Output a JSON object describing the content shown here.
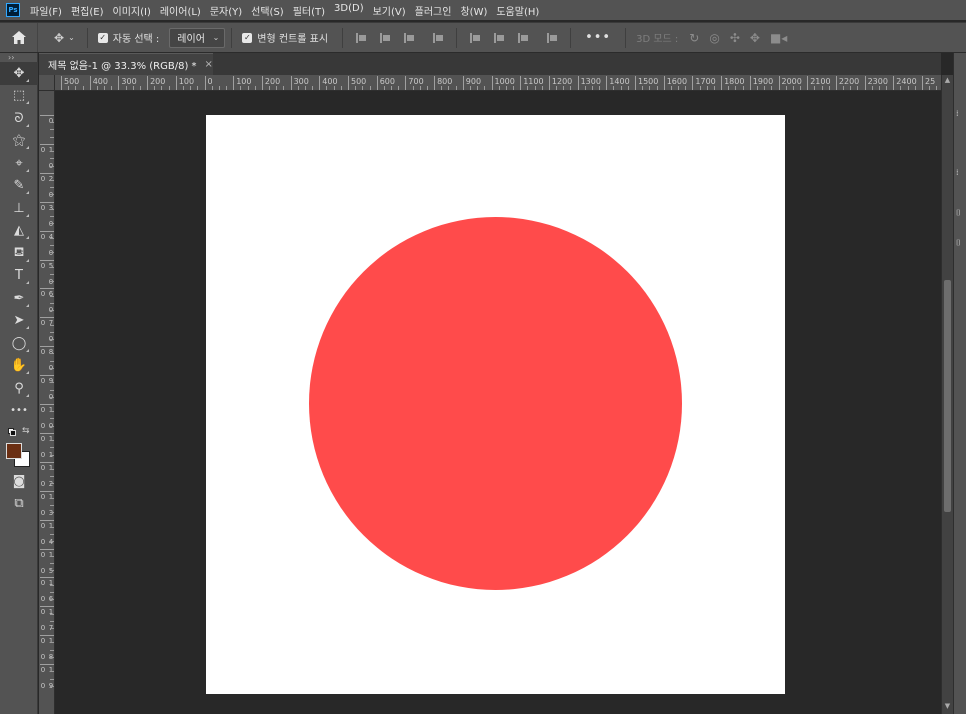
{
  "app": {
    "logo_text": "Ps"
  },
  "menu": [
    {
      "label": "파일(F)"
    },
    {
      "label": "편집(E)"
    },
    {
      "label": "이미지(I)"
    },
    {
      "label": "레이어(L)"
    },
    {
      "label": "문자(Y)"
    },
    {
      "label": "선택(S)"
    },
    {
      "label": "필터(T)"
    },
    {
      "label": "3D(D)"
    },
    {
      "label": "보기(V)"
    },
    {
      "label": "플러그인"
    },
    {
      "label": "창(W)"
    },
    {
      "label": "도움말(H)"
    }
  ],
  "options": {
    "home_icon": "home-icon",
    "move_icon": "move-tool-icon",
    "auto_select_checked": true,
    "auto_select_label": "자동 선택 :",
    "auto_select_value": "레이어",
    "transform_checked": true,
    "transform_label": "변형 컨트롤 표시",
    "more_label": "•••",
    "mode3d_label": "3D 모드 :"
  },
  "document": {
    "tab_title": "제목 없음-1 @ 33.3% (RGB/8) *",
    "close_glyph": "×",
    "zoom_percent": 33.3,
    "color_mode": "RGB/8",
    "canvas_color": "#ffffff",
    "shape": {
      "type": "ellipse",
      "fill": "#ff4b4b"
    }
  },
  "ruler": {
    "horizontal_labels": [
      "500",
      "400",
      "300",
      "200",
      "100",
      "0",
      "100",
      "200",
      "300",
      "400",
      "500",
      "600",
      "700",
      "800",
      "900",
      "1000",
      "1100",
      "1200",
      "1300",
      "1400",
      "1500",
      "1600",
      "1700",
      "1800",
      "1900",
      "2000",
      "2100",
      "2200",
      "2300",
      "2400",
      "25"
    ],
    "vertical_labels": [
      "0",
      "1 0 0",
      "2 0 0",
      "3 0 0",
      "4 0 0",
      "5 0 0",
      "6 0 0",
      "7 0 0",
      "8 0 0",
      "9 0 0",
      "1 0 0 0",
      "1 1 0 0",
      "1 2 0 0",
      "1 3 0 0",
      "1 4 0 0",
      "1 5 0 0",
      "1 6 0 0",
      "1 7 0 0",
      "1 8 0 0",
      "1 9 0 0"
    ]
  },
  "tools": [
    {
      "name": "move-tool-icon",
      "glyph": "✥",
      "active": true
    },
    {
      "name": "marquee-tool-icon",
      "glyph": "⬚"
    },
    {
      "name": "lasso-tool-icon",
      "glyph": "ᘐ"
    },
    {
      "name": "magic-wand-icon",
      "glyph": "⚝"
    },
    {
      "name": "eyedropper-icon",
      "glyph": "⌖"
    },
    {
      "name": "brush-icon",
      "glyph": "✎"
    },
    {
      "name": "stamp-icon",
      "glyph": "⊥"
    },
    {
      "name": "eraser-icon",
      "glyph": "◭"
    },
    {
      "name": "paint-bucket-icon",
      "glyph": "⛾"
    },
    {
      "name": "type-tool-icon",
      "glyph": "T"
    },
    {
      "name": "pen-tool-icon",
      "glyph": "✒"
    },
    {
      "name": "path-select-icon",
      "glyph": "➤"
    },
    {
      "name": "ellipse-tool-icon",
      "glyph": "◯"
    },
    {
      "name": "hand-tool-icon",
      "glyph": "✋"
    },
    {
      "name": "zoom-tool-icon",
      "glyph": "⚲"
    },
    {
      "name": "more-tools-icon",
      "glyph": "•••",
      "noarrow": true
    }
  ],
  "colors": {
    "foreground": "#6b2f13",
    "background": "#ffffff"
  },
  "extra_tools": [
    {
      "name": "quick-mask-icon",
      "glyph": "◙"
    },
    {
      "name": "screen-mode-icon",
      "glyph": "⧉"
    }
  ]
}
